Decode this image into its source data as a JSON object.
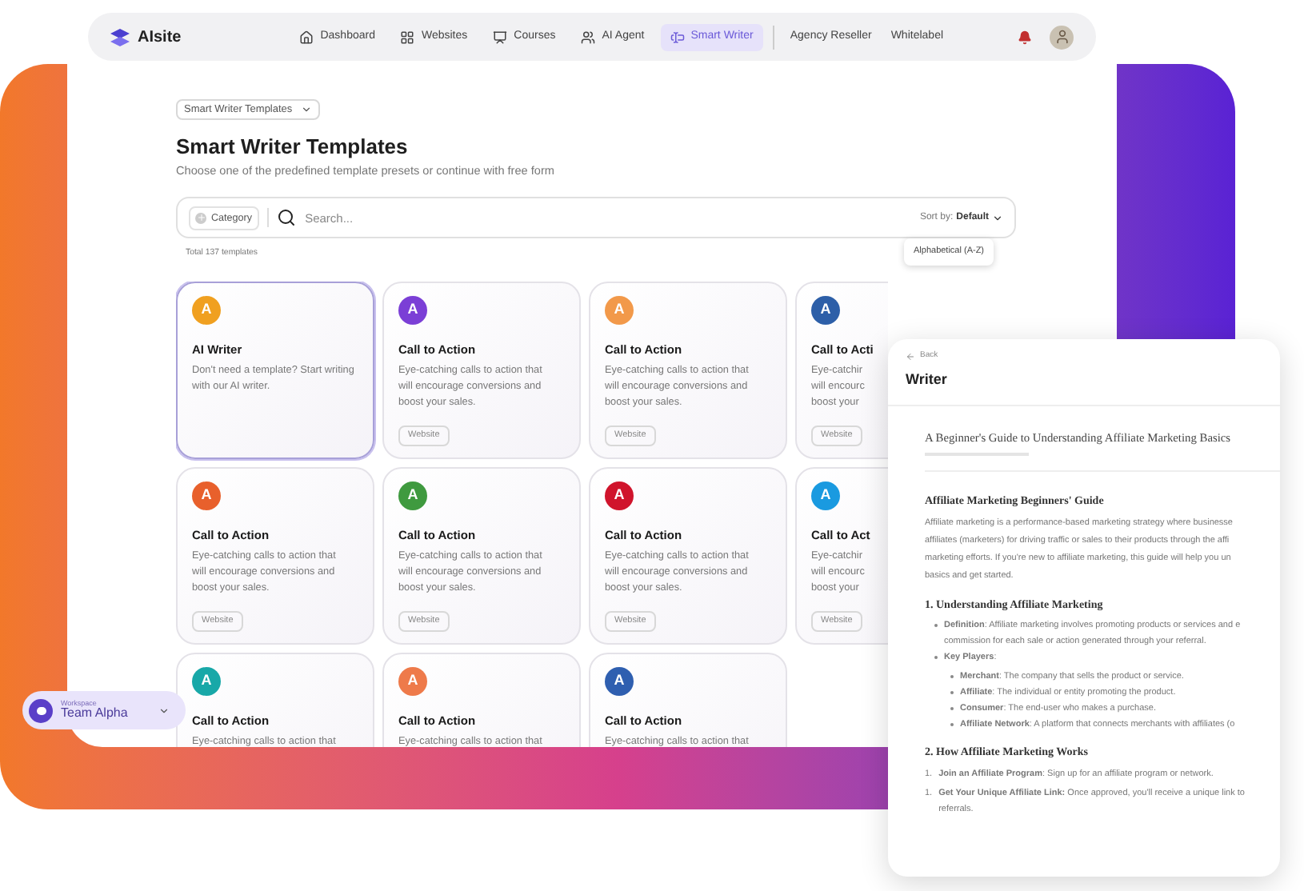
{
  "nav": {
    "logo": "AIsite",
    "items": [
      {
        "label": "Dashboard",
        "selected": false
      },
      {
        "label": "Websites",
        "selected": false
      },
      {
        "label": "Courses",
        "selected": false
      },
      {
        "label": "AI Agent",
        "selected": false
      },
      {
        "label": "Smart Writer",
        "selected": true
      }
    ],
    "links": [
      "Agency Reseller",
      "Whitelabel"
    ]
  },
  "breadcrumb": "Smart Writer Templates",
  "title": "Smart Writer Templates",
  "subtitle": "Choose one of the predefined template presets or continue with free form",
  "filter": {
    "category": "Category",
    "search_placeholder": "Search...",
    "sort_label": "Sort by:",
    "sort_value": "Default",
    "sort_option": "Alphabetical (A-Z)"
  },
  "total": "Total 137 templates",
  "cards": [
    {
      "letter": "A",
      "color": "#f0a020",
      "title": "AI Writer",
      "lines": [
        "Don't need a template? Start writing",
        "with our AI writer."
      ],
      "selected": true
    },
    {
      "letter": "A",
      "color": "#7b3fd6",
      "title": "Call to Action",
      "lines": [
        "Eye-catching calls to action that",
        "will encourage conversions and",
        "boost your sales."
      ],
      "tag": "Website",
      "selected": false
    },
    {
      "letter": "A",
      "color": "#f2994a",
      "title": "Call to Action",
      "lines": [
        "Eye-catching calls to action that",
        "will encourage conversions and",
        "boost your sales."
      ],
      "tag": "Website",
      "selected": false
    },
    {
      "letter": "A",
      "color": "#2d5fa8",
      "title": "Call to Acti",
      "lines": [
        "Eye-catchir",
        "will encourc",
        "boost your"
      ],
      "tag": "Website",
      "selected": false
    },
    {
      "letter": "A",
      "color": "#e8602c",
      "title": "Call to Action",
      "lines": [
        "Eye-catching calls to action that",
        "will encourage conversions and",
        "boost your sales."
      ],
      "tag": "Website",
      "selected": false
    },
    {
      "letter": "A",
      "color": "#3f9a3f",
      "title": "Call to Action",
      "lines": [
        "Eye-catching calls to action that",
        "will encourage conversions and",
        "boost your sales."
      ],
      "tag": "Website",
      "selected": false
    },
    {
      "letter": "A",
      "color": "#d0142c",
      "title": "Call to Action",
      "lines": [
        "Eye-catching calls to action that",
        "will encourage conversions and",
        "boost your sales."
      ],
      "tag": "Website",
      "selected": false
    },
    {
      "letter": "A",
      "color": "#1a9ae0",
      "title": "Call to Act",
      "lines": [
        "Eye-catchir",
        "will encourc",
        "boost your"
      ],
      "tag": "Website",
      "selected": false
    },
    {
      "letter": "A",
      "color": "#18a8a8",
      "title": "Call to Action",
      "lines": [
        "Eye-catching calls to action that"
      ],
      "selected": false
    },
    {
      "letter": "A",
      "color": "#ee7a4a",
      "title": "Call to Action",
      "lines": [
        "Eye-catching calls to action that"
      ],
      "selected": false
    },
    {
      "letter": "A",
      "color": "#2f5fb0",
      "title": "Call to Action",
      "lines": [
        "Eye-catching calls to action that"
      ],
      "selected": false
    }
  ],
  "workspace": {
    "label": "Workspace",
    "name": "Team Alpha"
  },
  "writer": {
    "back": "Back",
    "title": "Writer",
    "doc_title": "A Beginner's Guide to Understanding Affiliate Marketing Basics",
    "blocks": [
      {
        "kind": "heading",
        "text": "Affiliate Marketing Beginners' Guide"
      },
      {
        "kind": "paragraph",
        "lines": [
          "Affiliate marketing is a performance-based marketing strategy where businesse",
          "affiliates (marketers) for driving traffic or sales to their products through the affi",
          "marketing efforts. If you're new to affiliate marketing, this guide will help you un",
          "basics and get started."
        ]
      },
      {
        "kind": "heading",
        "text": "1. Understanding Affiliate Marketing"
      },
      {
        "kind": "bullet",
        "lines": [
          "**Definition**: Affiliate marketing involves promoting products or services and e",
          "commission for each sale or action generated through your referral."
        ]
      },
      {
        "kind": "bullet",
        "lines": [
          "**Key Players**:"
        ],
        "children": [
          {
            "kind": "bullet",
            "lines": [
              "**Merchant**: The company that sells the product or service."
            ]
          },
          {
            "kind": "bullet",
            "lines": [
              "**Affiliate**: The individual or entity promoting the product."
            ]
          },
          {
            "kind": "bullet",
            "lines": [
              "**Consumer**: The end-user who makes a purchase."
            ]
          },
          {
            "kind": "bullet",
            "lines": [
              "**Affiliate Network**: A platform that connects merchants with affiliates (o"
            ]
          }
        ]
      },
      {
        "kind": "heading",
        "text": "2. How Affiliate Marketing Works"
      },
      {
        "kind": "numbered",
        "marker": "1.",
        "lines": [
          "**Join an Affiliate Program**: Sign up for an affiliate program or network."
        ]
      },
      {
        "kind": "numbered",
        "marker": "1.",
        "lines": [
          "**Get Your Unique Affiliate Link:** Once approved, you'll receive a unique link to",
          "referrals."
        ]
      }
    ]
  }
}
